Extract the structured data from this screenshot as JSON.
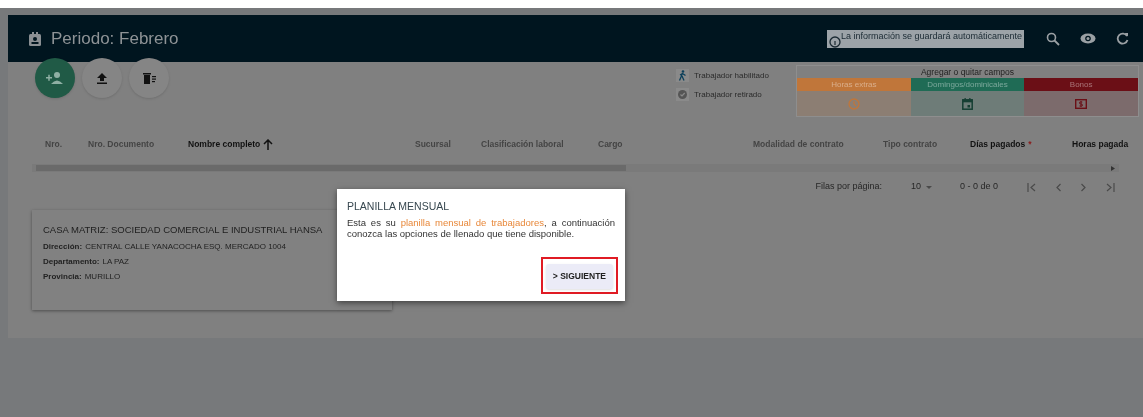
{
  "header": {
    "title": "Periodo: Febrero",
    "notice": "La información se guardará automáticamente"
  },
  "legend": [
    {
      "kind": "enabled",
      "label": "Trabajador habilitado"
    },
    {
      "kind": "retired",
      "label": "Trabajador retirado"
    }
  ],
  "fields_panel": {
    "title": "Agregar o quitar campos",
    "groups": [
      {
        "label": "Horas extras",
        "kind": "clock",
        "color": "#c0763a"
      },
      {
        "label": "Domingos/dominicales",
        "kind": "calendar",
        "color": "#1f6b55"
      },
      {
        "label": "Bonos",
        "kind": "money",
        "color": "#6b0f16"
      }
    ]
  },
  "table": {
    "columns": [
      {
        "label": "Nro.",
        "emphasized": false
      },
      {
        "label": "Nro. Documento",
        "emphasized": false
      },
      {
        "label": "Nombre completo",
        "emphasized": true,
        "sorted": true
      },
      {
        "label": "Sucursal",
        "emphasized": false
      },
      {
        "label": "Clasificación laboral",
        "emphasized": false
      },
      {
        "label": "Cargo",
        "emphasized": false
      },
      {
        "label": "Modalidad de contrato",
        "emphasized": false
      },
      {
        "label": "Tipo contrato",
        "emphasized": false
      },
      {
        "label": "Días pagados",
        "emphasized": true,
        "marker": "*"
      },
      {
        "label": "Horas pagada",
        "emphasized": true
      }
    ]
  },
  "pagination": {
    "rows_label": "Filas por página:",
    "rows_value": "10",
    "range": "0 - 0 de 0"
  },
  "branch": {
    "title": "CASA MATRIZ: SOCIEDAD COMERCIAL E INDUSTRIAL HANSA",
    "fields": [
      {
        "label": "Dirección:",
        "value": "CENTRAL CALLE YANACOCHA ESQ. MERCADO 1004"
      },
      {
        "label": "Departamento:",
        "value": "LA PAZ"
      },
      {
        "label": "Provincia:",
        "value": "MURILLO"
      }
    ]
  },
  "dialog": {
    "title": "PLANILLA MENSUAL",
    "body": "Esta es su **planilla mensual de trabajadores**, a continuación conozca las opciones de llenado que tiene disponible.",
    "button": "> SIGUIENTE",
    "button_highlighted": true
  }
}
